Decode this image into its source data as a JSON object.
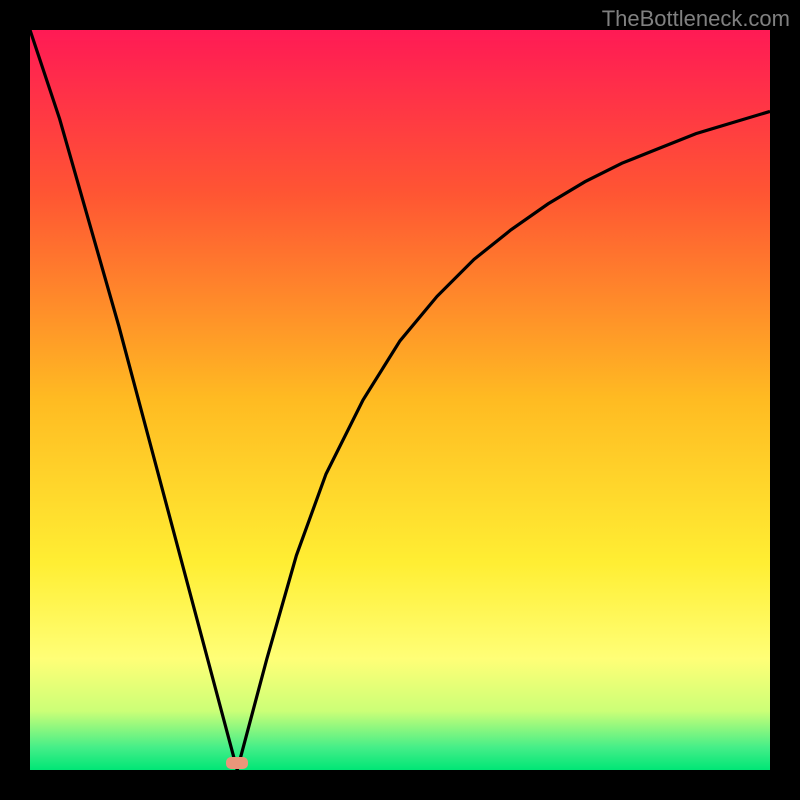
{
  "watermark": "TheBottleneck.com",
  "chart_data": {
    "type": "line",
    "title": "",
    "xlabel": "",
    "ylabel": "",
    "x_range": [
      0,
      100
    ],
    "y_range": [
      0,
      100
    ],
    "optimum_x": 28,
    "marker": {
      "x_pct": 28,
      "y_pct": 99
    },
    "curve_points": [
      {
        "x": 0,
        "y": 100
      },
      {
        "x": 4,
        "y": 88
      },
      {
        "x": 8,
        "y": 74
      },
      {
        "x": 12,
        "y": 60
      },
      {
        "x": 16,
        "y": 45
      },
      {
        "x": 20,
        "y": 30
      },
      {
        "x": 24,
        "y": 15
      },
      {
        "x": 28,
        "y": 0
      },
      {
        "x": 32,
        "y": 15
      },
      {
        "x": 36,
        "y": 29
      },
      {
        "x": 40,
        "y": 40
      },
      {
        "x": 45,
        "y": 50
      },
      {
        "x": 50,
        "y": 58
      },
      {
        "x": 55,
        "y": 64
      },
      {
        "x": 60,
        "y": 69
      },
      {
        "x": 65,
        "y": 73
      },
      {
        "x": 70,
        "y": 76.5
      },
      {
        "x": 75,
        "y": 79.5
      },
      {
        "x": 80,
        "y": 82
      },
      {
        "x": 85,
        "y": 84
      },
      {
        "x": 90,
        "y": 86
      },
      {
        "x": 95,
        "y": 87.5
      },
      {
        "x": 100,
        "y": 89
      }
    ],
    "gradient_stops": [
      {
        "offset": 0,
        "color": "#ff1a55"
      },
      {
        "offset": 22,
        "color": "#ff5533"
      },
      {
        "offset": 50,
        "color": "#ffbb22"
      },
      {
        "offset": 72,
        "color": "#ffee33"
      },
      {
        "offset": 85,
        "color": "#ffff77"
      },
      {
        "offset": 92,
        "color": "#ccff77"
      },
      {
        "offset": 97,
        "color": "#44ee88"
      },
      {
        "offset": 100,
        "color": "#00e676"
      }
    ]
  }
}
